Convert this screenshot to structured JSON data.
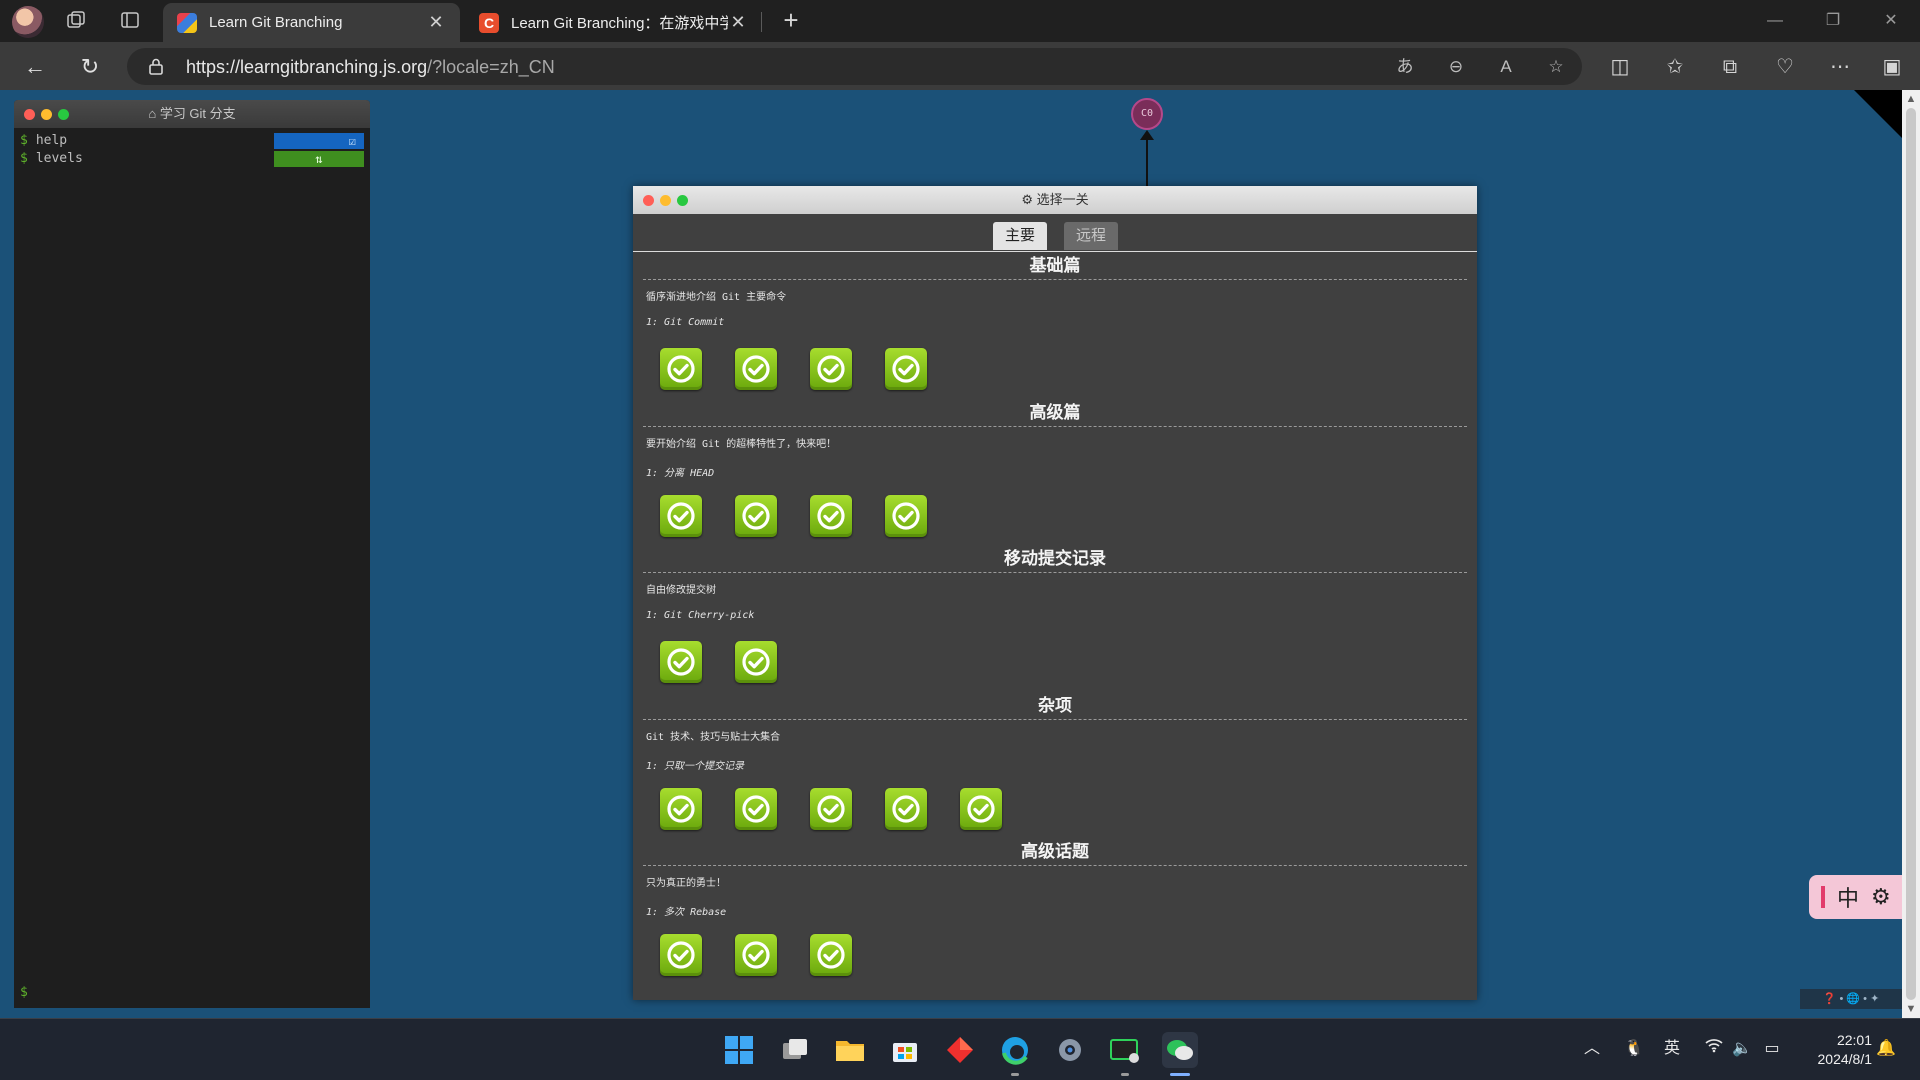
{
  "browser": {
    "tabs": [
      {
        "title": "Learn Git Branching",
        "active": true,
        "favicon_color": "#3b7ddd"
      },
      {
        "title": "Learn Git Branching：在游戏中学",
        "active": false,
        "favicon_color": "#e84d2d"
      }
    ],
    "url_host": "https://learngitbranching.js.org",
    "url_path": "/?locale=zh_CN",
    "icons": {
      "profile": "profile-avatar-icon",
      "workspaces": "workspaces-icon",
      "tab_actions": "tab-actions-icon",
      "back": "back-arrow-icon",
      "reload": "reload-icon",
      "lock": "lock-icon",
      "translate": "translate-icon",
      "zoom": "zoom-out-icon",
      "read_aloud": "read-aloud-icon",
      "favorite": "star-icon",
      "split": "split-screen-icon",
      "favorites": "favorites-list-icon",
      "collections": "collections-icon",
      "performance": "browser-essentials-icon",
      "more": "more-icon",
      "sidebar": "sidebar-icon"
    }
  },
  "terminal": {
    "title": "学习 Git 分支",
    "lines": [
      {
        "cmd": "help",
        "badge_color": "#1565c0"
      },
      {
        "cmd": "levels",
        "badge_color": "#3f8f1f"
      }
    ],
    "prompt": "$"
  },
  "graph": {
    "commit_label": "C0"
  },
  "level_select": {
    "title": "选择一关",
    "tabs": [
      "主要",
      "远程"
    ],
    "active_tab": "主要",
    "sections": [
      {
        "title": "基础篇",
        "about": "循序渐进地介绍 Git 主要命令",
        "level_name": "1: Git Commit",
        "completed": 4
      },
      {
        "title": "高级篇",
        "about": "要开始介绍 Git 的超棒特性了，快来吧！",
        "level_name": "1: 分离 HEAD",
        "completed": 4
      },
      {
        "title": "移动提交记录",
        "about": "自由修改提交树",
        "level_name": "1: Git Cherry-pick",
        "completed": 2
      },
      {
        "title": "杂项",
        "about": "Git 技术、技巧与贴士大集合",
        "level_name": "1: 只取一个提交记录",
        "completed": 5
      },
      {
        "title": "高级话题",
        "about": "只为真正的勇士！",
        "level_name": "1: 多次 Rebase",
        "completed": 3
      }
    ],
    "level_icon_color": "#8ec91e"
  },
  "ime_toolbar": {
    "mode": "中"
  },
  "taskbar": {
    "apps": [
      "start-icon",
      "task-view-icon",
      "file-explorer-icon",
      "store-icon",
      "git-client-icon",
      "edge-icon",
      "settings-icon",
      "terminal-icon",
      "wechat-icon"
    ],
    "tray_lang": "英",
    "time": "22:01",
    "date": "2024/8/1"
  }
}
